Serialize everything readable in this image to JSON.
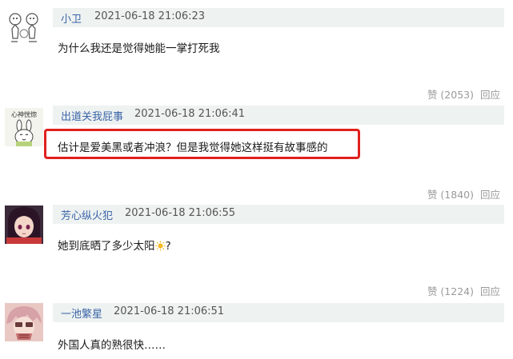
{
  "comments": [
    {
      "username": "小卫",
      "timestamp": "2021-06-18 21:06:23",
      "content": "为什么我还是觉得她能一掌打死我",
      "like_label": "赞 (2053)",
      "reply_label": "回应",
      "avatar_icon": "cartoon-sketch-avatar"
    },
    {
      "username": "出道关我屁事",
      "timestamp": "2021-06-18 21:06:41",
      "content": "估计是爱美黑或者冲浪？但是我觉得她这样挺有故事感的",
      "like_label": "赞 (1840)",
      "reply_label": "回应",
      "avatar_icon": "bunny-sticker-avatar",
      "avatar_text": "心神恍惚"
    },
    {
      "username": "芳心纵火犯",
      "timestamp": "2021-06-18 21:06:55",
      "content": "她到底晒了多少太阳",
      "content_suffix": "?",
      "like_label": "赞 (1224)",
      "reply_label": "回应",
      "avatar_icon": "anime-girl-avatar",
      "emoji_icon": "sun-emoji-icon"
    },
    {
      "username": "一池繁星",
      "timestamp": "2021-06-18 21:06:51",
      "content": "外国人真的熟很快……",
      "avatar_icon": "anime-boy-avatar"
    }
  ],
  "colors": {
    "username": "#3a64a8",
    "header_bg": "#eef2f1",
    "highlight": "#e0201c",
    "muted": "#9a9a9a"
  }
}
